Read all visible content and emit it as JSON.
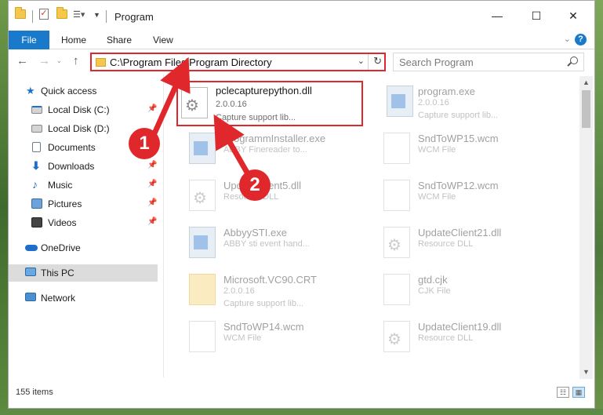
{
  "window": {
    "title": "Program",
    "minimize_glyph": "—",
    "maximize_glyph": "☐",
    "close_glyph": "✕"
  },
  "ribbon": {
    "tabs": [
      "File",
      "Home",
      "Share",
      "View"
    ],
    "expand_glyph": "⌄",
    "help_glyph": "?"
  },
  "navbar": {
    "back_glyph": "←",
    "forward_glyph": "→",
    "recent_glyph": "⌄",
    "up_glyph": "↑",
    "address": "C:\\Program Files\\Program Directory",
    "dropdown_glyph": "⌄",
    "refresh_glyph": "↻",
    "search_placeholder": "Search Program"
  },
  "sidebar": {
    "items": [
      {
        "label": "Quick access",
        "icon": "star-icon"
      },
      {
        "label": "Local Disk (C:)",
        "icon": "drive-icon",
        "pinned": true
      },
      {
        "label": "Local Disk (D:)",
        "icon": "drive-icon"
      },
      {
        "label": "Documents",
        "icon": "documents-icon",
        "pinned": true
      },
      {
        "label": "Downloads",
        "icon": "downloads-icon",
        "pinned": true
      },
      {
        "label": "Music",
        "icon": "music-icon",
        "pinned": true
      },
      {
        "label": "Pictures",
        "icon": "pictures-icon",
        "pinned": true
      },
      {
        "label": "Videos",
        "icon": "videos-icon",
        "pinned": true
      },
      {
        "label": "OneDrive",
        "icon": "onedrive-icon"
      },
      {
        "label": "This PC",
        "icon": "this-pc-icon",
        "selected": true
      },
      {
        "label": "Network",
        "icon": "network-icon"
      }
    ],
    "pin_glyph": "📌"
  },
  "files": [
    {
      "name": "pclecapturepython.dll",
      "line2": "2.0.0.16",
      "line3": "Capture support lib...",
      "icon": "dll",
      "highlight": true
    },
    {
      "name": "program.exe",
      "line2": "2.0.0.16",
      "line3": "Capture support lib...",
      "icon": "exe"
    },
    {
      "name": "ProgrammInstaller.exe",
      "line2": "ABBY Finereader to...",
      "line3": "",
      "icon": "exe"
    },
    {
      "name": "SndToWP15.wcm",
      "line2": "WCM File",
      "line3": "",
      "icon": "wcm"
    },
    {
      "name": "UpdateClient5.dll",
      "line2": "Resource DLL",
      "line3": "",
      "icon": "dll"
    },
    {
      "name": "SndToWP12.wcm",
      "line2": "WCM File",
      "line3": "",
      "icon": "wcm"
    },
    {
      "name": "AbbyySTI.exe",
      "line2": "ABBY sti event hand...",
      "line3": "",
      "icon": "exe"
    },
    {
      "name": "UpdateClient21.dll",
      "line2": "Resource DLL",
      "line3": "",
      "icon": "dll"
    },
    {
      "name": "Microsoft.VC90.CRT",
      "line2": "2.0.0.16",
      "line3": "Capture support lib...",
      "icon": "folder"
    },
    {
      "name": "gtd.cjk",
      "line2": "CJK File",
      "line3": "",
      "icon": "wcm"
    },
    {
      "name": "SndToWP14.wcm",
      "line2": "WCM File",
      "line3": "",
      "icon": "wcm"
    },
    {
      "name": "UpdateClient19.dll",
      "line2": "Resource DLL",
      "line3": "",
      "icon": "dll"
    }
  ],
  "status": {
    "item_count": "155 items"
  },
  "annotations": {
    "badge1": "1",
    "badge2": "2",
    "color": "#e0282c"
  }
}
